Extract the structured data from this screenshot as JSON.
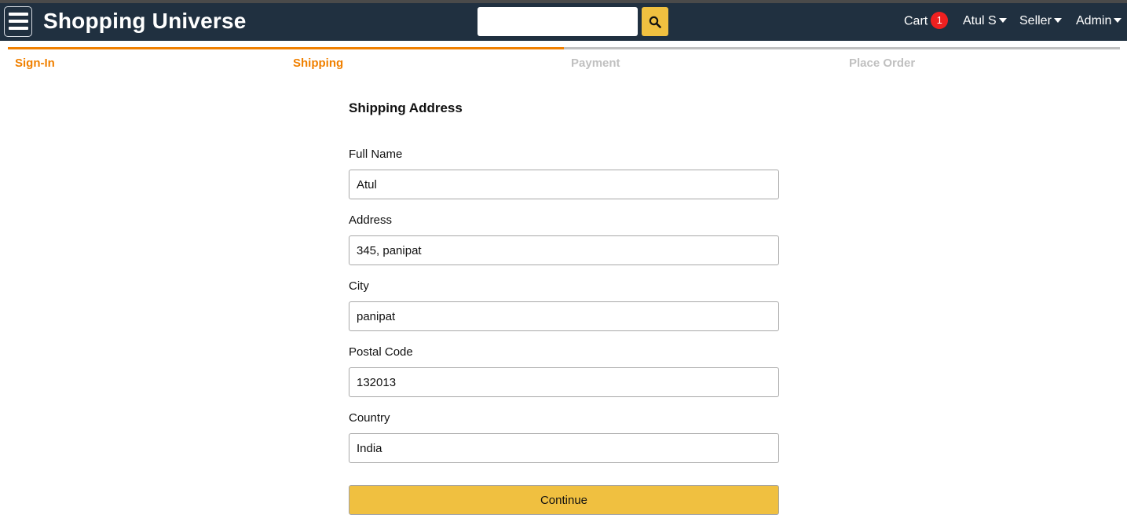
{
  "header": {
    "brand": "Shopping Universe",
    "search": {
      "value": "",
      "placeholder": ""
    },
    "nav": {
      "cart_label": "Cart",
      "cart_count": "1",
      "user_label": "Atul S",
      "seller_label": "Seller",
      "admin_label": "Admin"
    }
  },
  "steps": [
    {
      "label": "Sign-In",
      "active": true
    },
    {
      "label": "Shipping",
      "active": true
    },
    {
      "label": "Payment",
      "active": false
    },
    {
      "label": "Place Order",
      "active": false
    }
  ],
  "form": {
    "title": "Shipping Address",
    "fields": [
      {
        "label": "Full Name",
        "value": "Atul"
      },
      {
        "label": "Address",
        "value": "345, panipat"
      },
      {
        "label": "City",
        "value": "panipat"
      },
      {
        "label": "Postal Code",
        "value": "132013"
      },
      {
        "label": "Country",
        "value": "India"
      }
    ],
    "submit_label": "Continue"
  },
  "colors": {
    "header_bg": "#203040",
    "accent": "#f0c040",
    "step_active": "#f08000",
    "step_inactive": "#c0c0c0",
    "badge": "#f02020"
  },
  "icons": {
    "menu": "hamburger-menu-icon",
    "search": "search-icon",
    "caret": "caret-down-icon"
  }
}
